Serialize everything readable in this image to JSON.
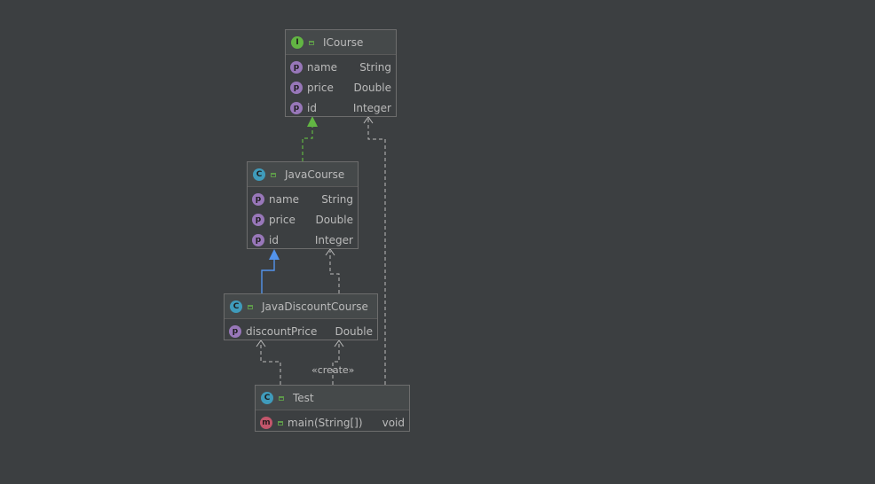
{
  "colors": {
    "background": "#3c3f41",
    "implements_arrow": "#62b543",
    "extends_arrow": "#5394ec",
    "dependency_line": "#bbbbbb"
  },
  "nodes": {
    "icourse": {
      "icon": "interface-icon",
      "badge": "I",
      "title": "ICourse",
      "fields": [
        {
          "name": "name",
          "type": "String"
        },
        {
          "name": "price",
          "type": "Double"
        },
        {
          "name": "id",
          "type": "Integer"
        }
      ]
    },
    "javacourse": {
      "icon": "class-icon",
      "badge": "C",
      "title": "JavaCourse",
      "fields": [
        {
          "name": "name",
          "type": "String"
        },
        {
          "name": "price",
          "type": "Double"
        },
        {
          "name": "id",
          "type": "Integer"
        }
      ]
    },
    "javadiscountcourse": {
      "icon": "class-icon",
      "badge": "C",
      "title": "JavaDiscountCourse",
      "fields": [
        {
          "name": "discountPrice",
          "type": "Double"
        }
      ]
    },
    "test": {
      "icon": "class-icon",
      "badge": "C",
      "title": "Test",
      "methods": [
        {
          "name": "main(String[])",
          "type": "void"
        }
      ]
    }
  },
  "edges": {
    "create_label": "«create»"
  }
}
